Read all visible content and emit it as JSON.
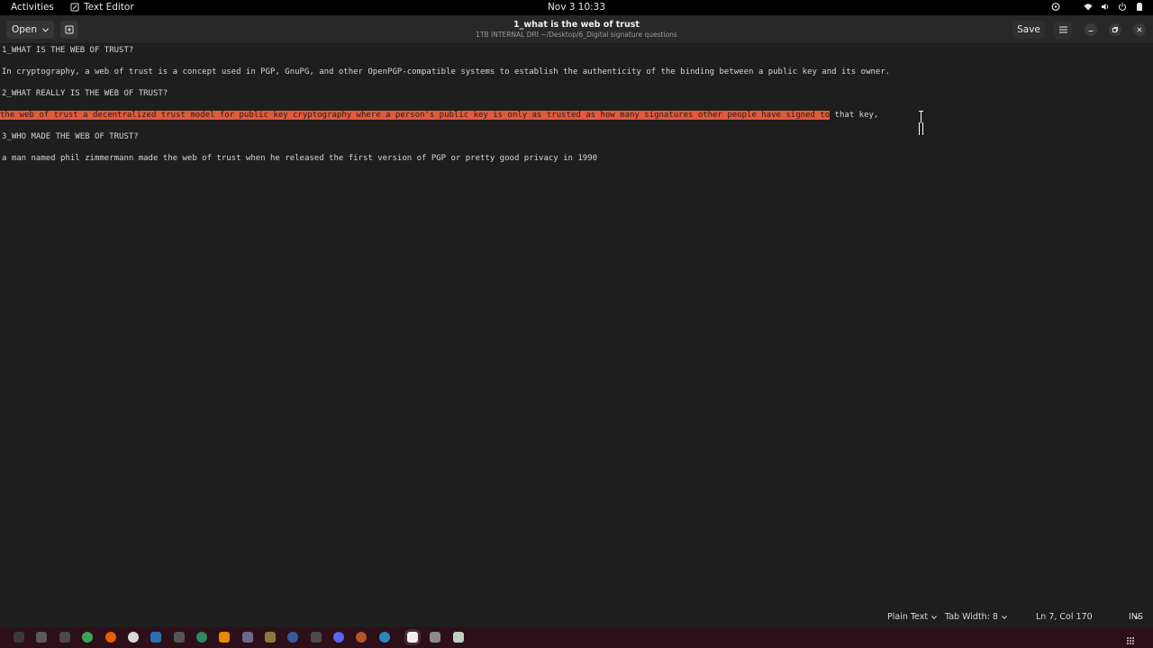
{
  "topbar": {
    "activities": "Activities",
    "app_name": "Text Editor",
    "clock": "Nov 3  10:33"
  },
  "header": {
    "open_label": "Open",
    "save_label": "Save",
    "title": "1_what is the web of trust",
    "subtitle": "1TB INTERNAL DRI ~/Desktop/6_Digital signature questions"
  },
  "document": {
    "lines": [
      "1_WHAT IS THE WEB OF TRUST?",
      "In cryptography, a web of trust is a concept used in PGP, GnuPG, and other OpenPGP-compatible systems to establish the authenticity of the binding between a public key and its owner.",
      "2_WHAT REALLY IS THE WEB OF TRUST?",
      "3_WHO MADE THE WEB OF TRUST?",
      "a man named phil zimmermann made the web of trust when he released the first version of PGP or pretty good privacy in 1990"
    ],
    "selected_text": "the web of trust a decentralized trust model for public key cryptography where a person's public key is only as trusted as how many signatures other people have signed to",
    "unselected_text": " that key,"
  },
  "statusbar": {
    "language": "Plain Text",
    "tab_width": "Tab Width: 8",
    "position": "Ln 7, Col 170",
    "mode": "INS"
  },
  "colors": {
    "selection": "#e25a3c",
    "dock_background": "#2c0f19"
  }
}
